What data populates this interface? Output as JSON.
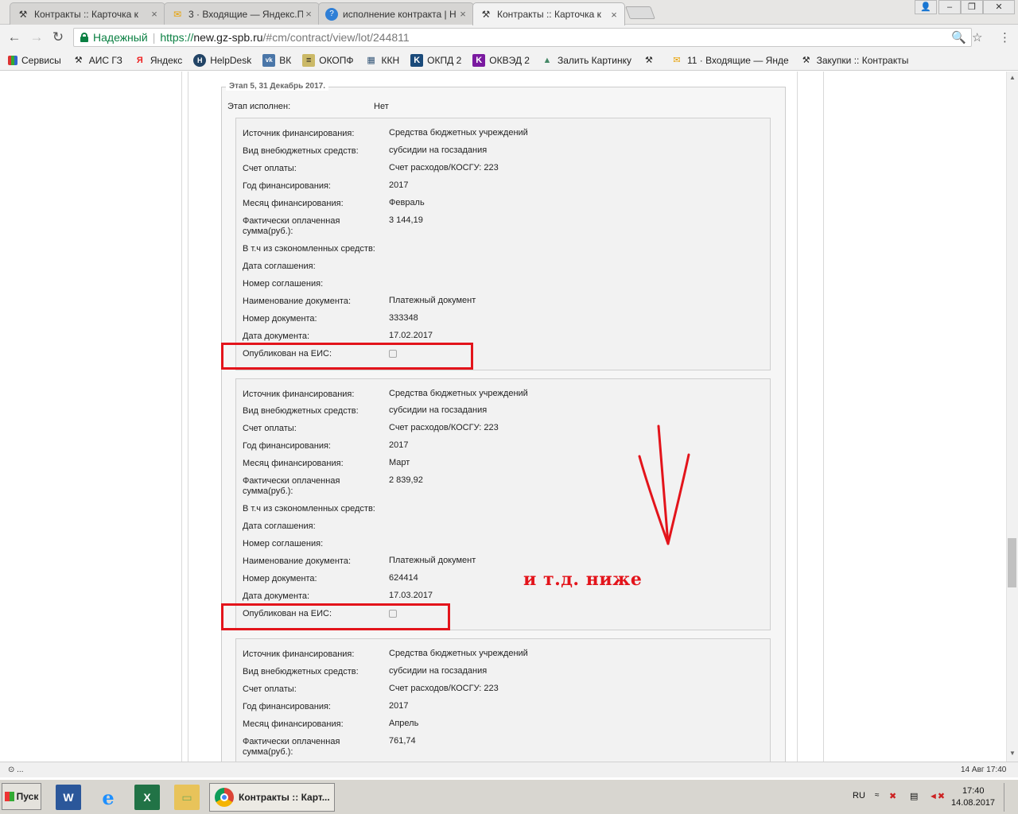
{
  "browser": {
    "tabs": [
      {
        "label": "Контракты :: Карточка к",
        "active": false
      },
      {
        "label": "3 · Входящие — Яндекс.П",
        "active": false
      },
      {
        "label": "исполнение контракта | Н",
        "active": false
      },
      {
        "label": "Контракты :: Карточка к",
        "active": true
      }
    ],
    "secure_label": "Надежный",
    "url_scheme": "https://",
    "url_host": "new.gz-spb.ru",
    "url_path": "/#cm/contract/view/lot/244811",
    "bookmarks": [
      {
        "label": "Сервисы",
        "icon": "apps-icon"
      },
      {
        "label": "АИС ГЗ",
        "icon": "gavel-icon"
      },
      {
        "label": "Яндекс",
        "icon": "yandex-icon"
      },
      {
        "label": "HelpDesk",
        "icon": "helpdesk-icon"
      },
      {
        "label": "ВК",
        "icon": "vk-icon"
      },
      {
        "label": "ОКОПФ",
        "icon": "doc-icon"
      },
      {
        "label": "ККН",
        "icon": "kkn-icon"
      },
      {
        "label": "ОКПД 2",
        "icon": "k-icon"
      },
      {
        "label": "ОКВЭД 2",
        "icon": "k-purple-icon"
      },
      {
        "label": "Залить Картинку",
        "icon": "image-icon"
      },
      {
        "label": "",
        "icon": "gavel-icon"
      },
      {
        "label": "11 · Входящие — Янде",
        "icon": "mail-icon"
      },
      {
        "label": "Закупки :: Контракты",
        "icon": "gavel-icon"
      }
    ]
  },
  "stage": {
    "title": "Этап 5, 31 Декабрь 2017.",
    "done_label": "Этап исполнен:",
    "done_value": "Нет"
  },
  "labels": {
    "source": "Источник финансирования:",
    "extra_type": "Вид внебюджетных средств:",
    "account": "Счет оплаты:",
    "year": "Год финансирования:",
    "month": "Месяц финансирования:",
    "paid": "Фактически оплаченная сумма(руб.):",
    "savings": "В т.ч из сэкономленных средств:",
    "agreement_date": "Дата соглашения:",
    "agreement_no": "Номер соглашения:",
    "doc_name": "Наименование документа:",
    "doc_no": "Номер документа:",
    "doc_date": "Дата документа:",
    "published": "Опубликован на ЕИС:"
  },
  "payments": [
    {
      "source": "Средства бюджетных учреждений",
      "extra_type": "субсидии на госзадания",
      "account": "Счет расходов/КОСГУ: 223",
      "year": "2017",
      "month": "Февраль",
      "paid": "3 144,19",
      "doc_name": "Платежный документ",
      "doc_no": "333348",
      "doc_date": "17.02.2017",
      "published": false
    },
    {
      "source": "Средства бюджетных учреждений",
      "extra_type": "субсидии на госзадания",
      "account": "Счет расходов/КОСГУ: 223",
      "year": "2017",
      "month": "Март",
      "paid": "2 839,92",
      "doc_name": "Платежный документ",
      "doc_no": "624414",
      "doc_date": "17.03.2017",
      "published": false
    },
    {
      "source": "Средства бюджетных учреждений",
      "extra_type": "субсидии на госзадания",
      "account": "Счет расходов/КОСГУ: 223",
      "year": "2017",
      "month": "Апрель",
      "paid": "761,74"
    }
  ],
  "annotation": {
    "text": "и т.д. ниже",
    "color": "#e3141b"
  },
  "status": {
    "left": "⊙ ...",
    "right": "14 Авг 17:40"
  },
  "taskbar": {
    "start": "Пуск",
    "task_label": "Контракты :: Карт...",
    "lang": "RU",
    "time": "17:40",
    "date": "14.08.2017"
  }
}
